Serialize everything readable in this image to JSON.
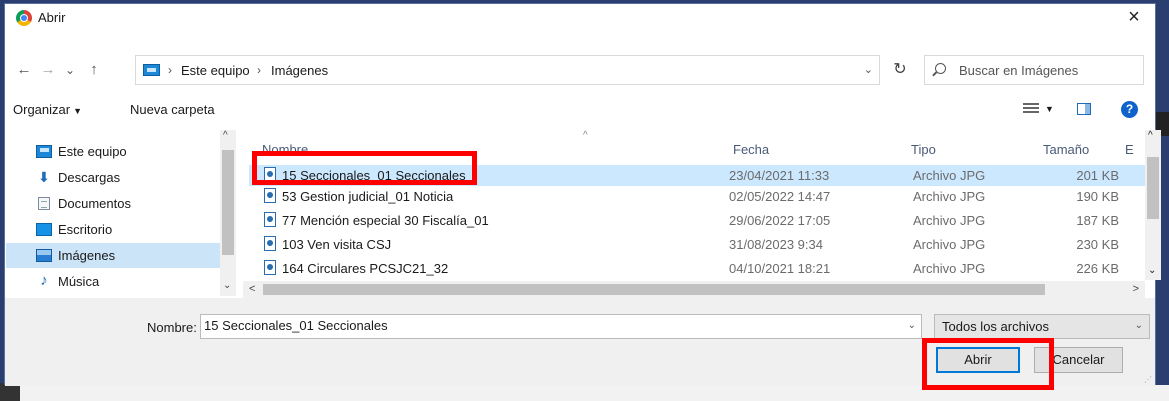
{
  "window": {
    "title": "Abrir",
    "close_symbol": "×"
  },
  "address": {
    "back_symbol": "←",
    "forward_symbol": "→",
    "recent_symbol": "⌄",
    "up_symbol": "↑",
    "crumbs": [
      "Este equipo",
      "Imágenes"
    ],
    "separator": "›",
    "dropdown_symbol": "⌄",
    "refresh_symbol": "↻",
    "search_placeholder": "Buscar en Imágenes"
  },
  "toolbar": {
    "organize_label": "Organizar",
    "new_folder_label": "Nueva carpeta",
    "help_symbol": "?"
  },
  "sidebar": {
    "items": [
      {
        "label": "Este equipo",
        "icon": "computer-icon"
      },
      {
        "label": "Descargas",
        "icon": "download-icon"
      },
      {
        "label": "Documentos",
        "icon": "document-icon"
      },
      {
        "label": "Escritorio",
        "icon": "desktop-icon"
      },
      {
        "label": "Imágenes",
        "icon": "pictures-icon",
        "selected": true
      },
      {
        "label": "Música",
        "icon": "music-icon"
      }
    ]
  },
  "file_list": {
    "columns": [
      "Nombre",
      "Fecha",
      "Tipo",
      "Tamaño",
      "E"
    ],
    "rows": [
      {
        "name": "15 Seccionales_01 Seccionales",
        "date": "23/04/2021 11:33",
        "type": "Archivo JPG",
        "size": "201 KB",
        "selected": true
      },
      {
        "name": "53 Gestion judicial_01 Noticia",
        "date": "02/05/2022 14:47",
        "type": "Archivo JPG",
        "size": "190 KB"
      },
      {
        "name": "77 Mención especial 30 Fiscalía_01",
        "date": "29/06/2022 17:05",
        "type": "Archivo JPG",
        "size": "187 KB"
      },
      {
        "name": "103 Ven visita CSJ",
        "date": "31/08/2023 9:34",
        "type": "Archivo JPG",
        "size": "230 KB"
      },
      {
        "name": "164 Circulares PCSJC21_32",
        "date": "04/10/2021 18:21",
        "type": "Archivo JPG",
        "size": "226 KB"
      }
    ]
  },
  "bottom": {
    "name_label": "Nombre:",
    "name_value": "15 Seccionales_01 Seccionales",
    "filter_value": "Todos los archivos",
    "open_button": "Abrir",
    "cancel_button": "Cancelar"
  },
  "colors": {
    "highlight_border": "#ff0000",
    "selection": "#cce8ff",
    "accent": "#0078d7"
  }
}
